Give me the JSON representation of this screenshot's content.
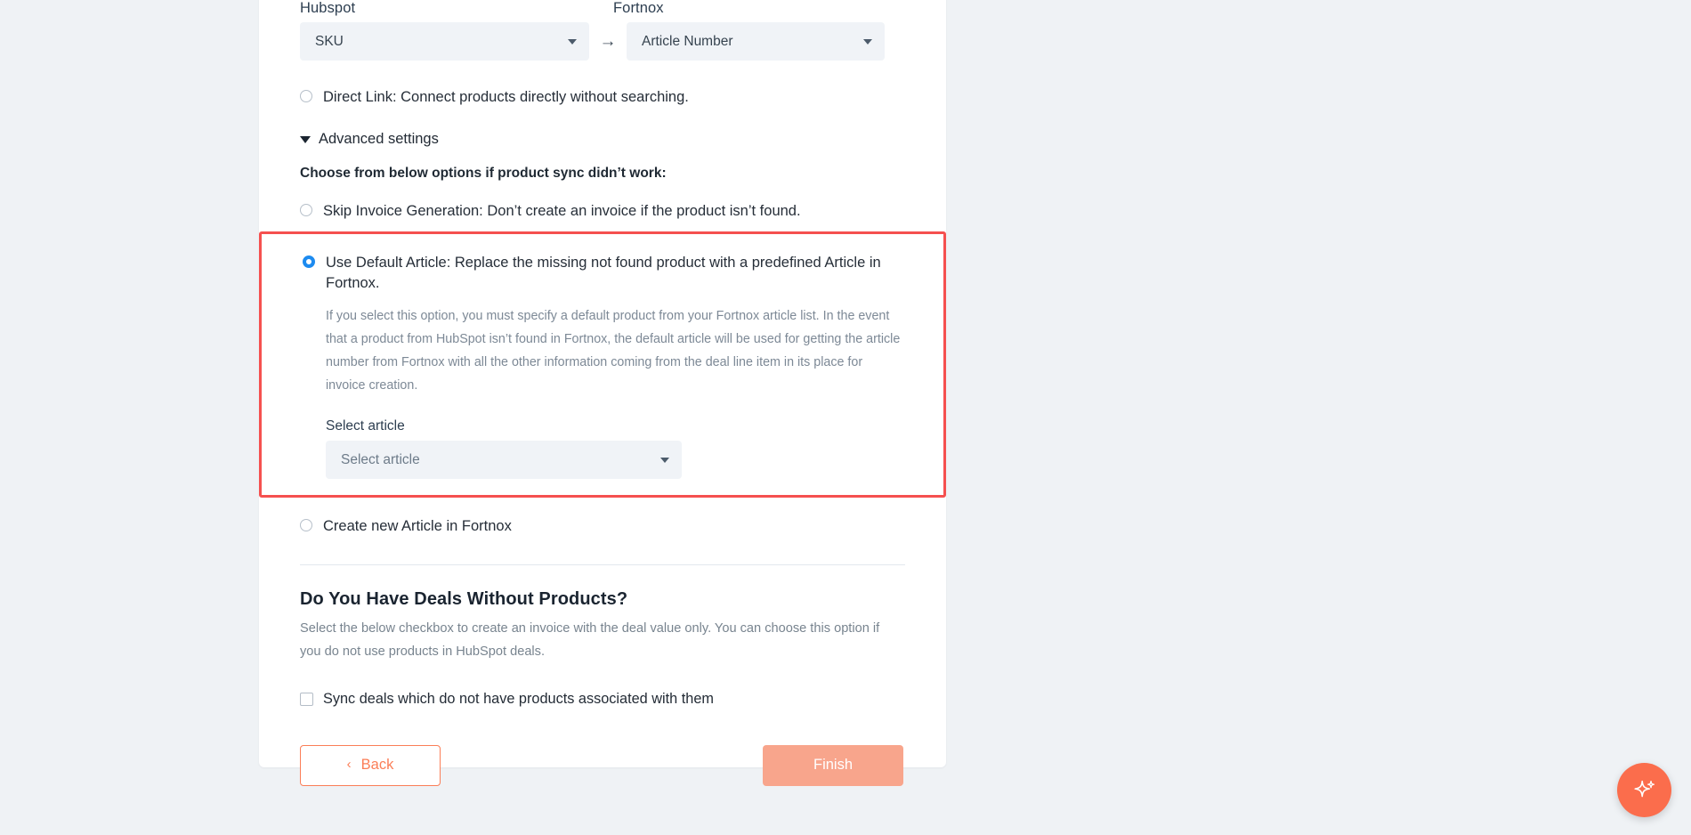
{
  "mapping": {
    "hubspot_label": "Hubspot",
    "fortnox_label": "Fortnox",
    "hubspot_value": "SKU",
    "fortnox_value": "Article Number",
    "arrow": "→"
  },
  "options": {
    "direct_link": "Direct Link: Connect products directly without searching.",
    "advanced_settings": "Advanced settings",
    "choose_heading": "Choose from below options if product sync didn’t work:",
    "skip_invoice": "Skip Invoice Generation: Don’t create an invoice if the product isn’t found.",
    "use_default_article": "Use Default Article: Replace the missing not found product with a predefined Article in Fortnox.",
    "use_default_article_desc": "If you select this option, you must specify a default product from your Fortnox article list. In the event that a product from HubSpot isn’t found in Fortnox, the default article will be used for getting the article number from Fortnox with all the other information coming from the deal line item in its place for invoice creation.",
    "select_article_label": "Select article",
    "select_article_placeholder": "Select article",
    "create_new_article": "Create new Article in Fortnox"
  },
  "deals_section": {
    "title": "Do You Have Deals Without Products?",
    "description": "Select the below checkbox to create an invoice with the deal value only. You can choose this option if you do not use products in HubSpot deals.",
    "checkbox_label": "Sync deals which do not have products associated with them"
  },
  "footer": {
    "back_label": "Back",
    "back_chevron": "‹",
    "finish_label": "Finish"
  },
  "colors": {
    "highlight_border": "#f5504f",
    "radio_selected": "#1d8bf0",
    "primary_orange": "#fb7e57",
    "finish_disabled": "#f8a58c",
    "fab": "#fb6d4c",
    "page_bg": "#eff2f5"
  }
}
